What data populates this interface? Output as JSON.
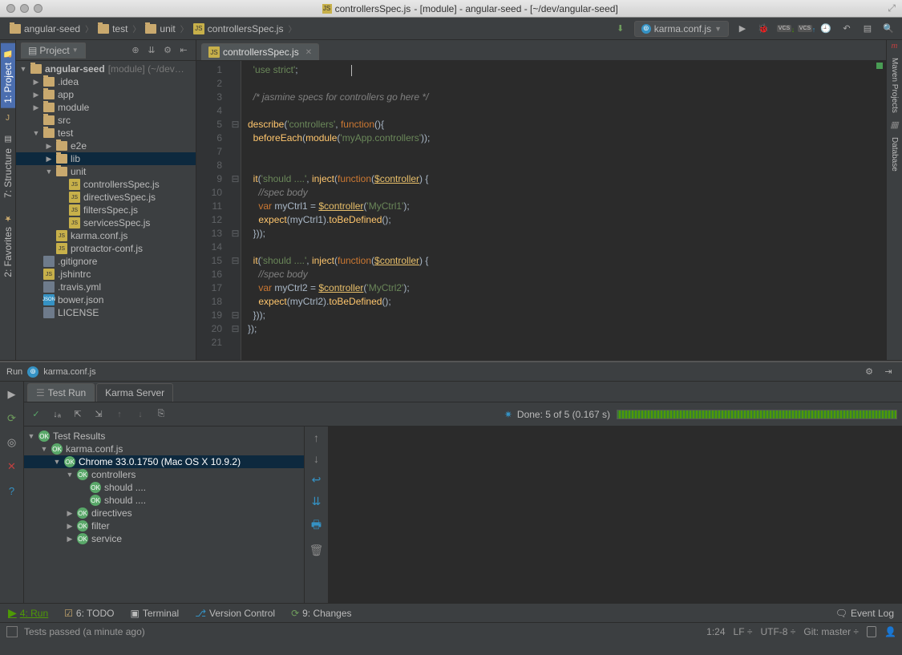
{
  "titlebar": {
    "filename": "controllersSpec.js",
    "title_rest": " - [module] - angular-seed - [~/dev/angular-seed]"
  },
  "breadcrumb": {
    "items": [
      "angular-seed",
      "test",
      "unit",
      "controllersSpec.js"
    ]
  },
  "run_config": {
    "name": "karma.conf.js"
  },
  "project_panel": {
    "title": "Project",
    "tree": [
      {
        "ind": 0,
        "arrow": "down",
        "icon": "folder",
        "name": "angular-seed",
        "bold": true,
        "hint": " [module] (~/dev…"
      },
      {
        "ind": 1,
        "arrow": "right",
        "icon": "folder",
        "name": ".idea"
      },
      {
        "ind": 1,
        "arrow": "right",
        "icon": "folder",
        "name": "app"
      },
      {
        "ind": 1,
        "arrow": "right",
        "icon": "folder",
        "name": "module"
      },
      {
        "ind": 1,
        "arrow": "none",
        "icon": "folder",
        "name": "src"
      },
      {
        "ind": 1,
        "arrow": "down",
        "icon": "folder",
        "name": "test"
      },
      {
        "ind": 2,
        "arrow": "right",
        "icon": "folder",
        "name": "e2e"
      },
      {
        "ind": 2,
        "arrow": "right",
        "icon": "folder",
        "name": "lib",
        "sel": true
      },
      {
        "ind": 2,
        "arrow": "down",
        "icon": "folder",
        "name": "unit"
      },
      {
        "ind": 3,
        "arrow": "none",
        "icon": "js",
        "name": "controllersSpec.js"
      },
      {
        "ind": 3,
        "arrow": "none",
        "icon": "js",
        "name": "directivesSpec.js"
      },
      {
        "ind": 3,
        "arrow": "none",
        "icon": "js",
        "name": "filtersSpec.js"
      },
      {
        "ind": 3,
        "arrow": "none",
        "icon": "js",
        "name": "servicesSpec.js"
      },
      {
        "ind": 2,
        "arrow": "none",
        "icon": "js",
        "name": "karma.conf.js",
        "blue": true
      },
      {
        "ind": 2,
        "arrow": "none",
        "icon": "js",
        "name": "protractor-conf.js"
      },
      {
        "ind": 1,
        "arrow": "none",
        "icon": "file",
        "name": ".gitignore"
      },
      {
        "ind": 1,
        "arrow": "none",
        "icon": "js",
        "name": ".jshintrc"
      },
      {
        "ind": 1,
        "arrow": "none",
        "icon": "file",
        "name": ".travis.yml"
      },
      {
        "ind": 1,
        "arrow": "none",
        "icon": "json",
        "name": "bower.json"
      },
      {
        "ind": 1,
        "arrow": "none",
        "icon": "file",
        "name": "LICENSE"
      }
    ]
  },
  "editor_tab": "controllersSpec.js",
  "code": {
    "line_count": 21,
    "lines": [
      {
        "t": "  ",
        "seg": [
          {
            "c": "str",
            "t": "'use strict'"
          },
          {
            "c": "id",
            "t": ";"
          }
        ]
      },
      {
        "t": ""
      },
      {
        "t": "  ",
        "seg": [
          {
            "c": "com",
            "t": "/* jasmine specs for controllers go here */"
          }
        ]
      },
      {
        "t": ""
      },
      {
        "seg": [
          {
            "c": "fn",
            "t": "describe"
          },
          {
            "c": "id",
            "t": "("
          },
          {
            "c": "str",
            "t": "'controllers'"
          },
          {
            "c": "id",
            "t": ", "
          },
          {
            "c": "kw",
            "t": "function"
          },
          {
            "c": "id",
            "t": "(){"
          }
        ]
      },
      {
        "t": "  ",
        "seg": [
          {
            "c": "fn",
            "t": "beforeEach"
          },
          {
            "c": "id",
            "t": "("
          },
          {
            "c": "fn",
            "t": "module"
          },
          {
            "c": "id",
            "t": "("
          },
          {
            "c": "str",
            "t": "'myApp.controllers'"
          },
          {
            "c": "id",
            "t": "));"
          }
        ]
      },
      {
        "t": ""
      },
      {
        "t": ""
      },
      {
        "t": "  ",
        "seg": [
          {
            "c": "fn",
            "t": "it"
          },
          {
            "c": "id",
            "t": "("
          },
          {
            "c": "str",
            "t": "'should ....'"
          },
          {
            "c": "id",
            "t": ", "
          },
          {
            "c": "fn",
            "t": "inject"
          },
          {
            "c": "id",
            "t": "("
          },
          {
            "c": "kw",
            "t": "function"
          },
          {
            "c": "id",
            "t": "("
          },
          {
            "c": "par",
            "t": "$controller"
          },
          {
            "c": "id",
            "t": ") {"
          }
        ]
      },
      {
        "t": "    ",
        "seg": [
          {
            "c": "com",
            "t": "//spec body"
          }
        ]
      },
      {
        "t": "    ",
        "seg": [
          {
            "c": "kw",
            "t": "var "
          },
          {
            "c": "id",
            "t": "myCtrl1 = "
          },
          {
            "c": "par",
            "t": "$controller"
          },
          {
            "c": "id",
            "t": "("
          },
          {
            "c": "str",
            "t": "'MyCtrl1'"
          },
          {
            "c": "id",
            "t": ");"
          }
        ]
      },
      {
        "t": "    ",
        "seg": [
          {
            "c": "fn",
            "t": "expect"
          },
          {
            "c": "id",
            "t": "(myCtrl1)."
          },
          {
            "c": "fn",
            "t": "toBeDefined"
          },
          {
            "c": "id",
            "t": "();"
          }
        ]
      },
      {
        "t": "  ",
        "seg": [
          {
            "c": "id",
            "t": "}));"
          }
        ]
      },
      {
        "t": ""
      },
      {
        "t": "  ",
        "seg": [
          {
            "c": "fn",
            "t": "it"
          },
          {
            "c": "id",
            "t": "("
          },
          {
            "c": "str",
            "t": "'should ....'"
          },
          {
            "c": "id",
            "t": ", "
          },
          {
            "c": "fn",
            "t": "inject"
          },
          {
            "c": "id",
            "t": "("
          },
          {
            "c": "kw",
            "t": "function"
          },
          {
            "c": "id",
            "t": "("
          },
          {
            "c": "par",
            "t": "$controller"
          },
          {
            "c": "id",
            "t": ") {"
          }
        ]
      },
      {
        "t": "    ",
        "seg": [
          {
            "c": "com",
            "t": "//spec body"
          }
        ]
      },
      {
        "t": "    ",
        "seg": [
          {
            "c": "kw",
            "t": "var "
          },
          {
            "c": "id",
            "t": "myCtrl2 = "
          },
          {
            "c": "par",
            "t": "$controller"
          },
          {
            "c": "id",
            "t": "("
          },
          {
            "c": "str",
            "t": "'MyCtrl2'"
          },
          {
            "c": "id",
            "t": ");"
          }
        ]
      },
      {
        "t": "    ",
        "seg": [
          {
            "c": "fn",
            "t": "expect"
          },
          {
            "c": "id",
            "t": "(myCtrl2)."
          },
          {
            "c": "fn",
            "t": "toBeDefined"
          },
          {
            "c": "id",
            "t": "();"
          }
        ]
      },
      {
        "t": "  ",
        "seg": [
          {
            "c": "id",
            "t": "}));"
          }
        ]
      },
      {
        "seg": [
          {
            "c": "id",
            "t": "});"
          }
        ]
      },
      {
        "t": ""
      }
    ],
    "fold": {
      "5": "⊟",
      "9": "⊟",
      "13": "⊟",
      "15": "⊟",
      "19": "⊟",
      "20": "⊟"
    }
  },
  "run": {
    "title": "Run",
    "config": "karma.conf.js",
    "tabs": [
      "Test Run",
      "Karma Server"
    ],
    "done": "Done: 5 of 5  (0.167 s)",
    "results": [
      {
        "ind": 0,
        "arrow": "down",
        "name": "Test Results"
      },
      {
        "ind": 1,
        "arrow": "down",
        "name": "karma.conf.js"
      },
      {
        "ind": 2,
        "arrow": "down",
        "name": "Chrome 33.0.1750 (Mac OS X 10.9.2)",
        "sel": true
      },
      {
        "ind": 3,
        "arrow": "down",
        "name": "controllers"
      },
      {
        "ind": 4,
        "arrow": "none",
        "name": "should ...."
      },
      {
        "ind": 4,
        "arrow": "none",
        "name": "should ...."
      },
      {
        "ind": 3,
        "arrow": "right",
        "name": "directives"
      },
      {
        "ind": 3,
        "arrow": "right",
        "name": "filter"
      },
      {
        "ind": 3,
        "arrow": "right",
        "name": "service"
      }
    ]
  },
  "tool_windows": {
    "run": "4: Run",
    "todo": "6: TODO",
    "terminal": "Terminal",
    "vcs": "Version Control",
    "changes": "9: Changes",
    "event_log": "Event Log"
  },
  "status": {
    "msg": "Tests passed (a minute ago)",
    "pos": "1:24",
    "le": "LF",
    "enc": "UTF-8",
    "git": "Git: master"
  },
  "rails": {
    "left": [
      {
        "label": "1: Project",
        "active": true
      },
      {
        "label": "7: Structure"
      },
      {
        "label": "2: Favorites"
      }
    ],
    "right": [
      {
        "label": "Maven Projects"
      },
      {
        "label": "Database"
      }
    ]
  }
}
